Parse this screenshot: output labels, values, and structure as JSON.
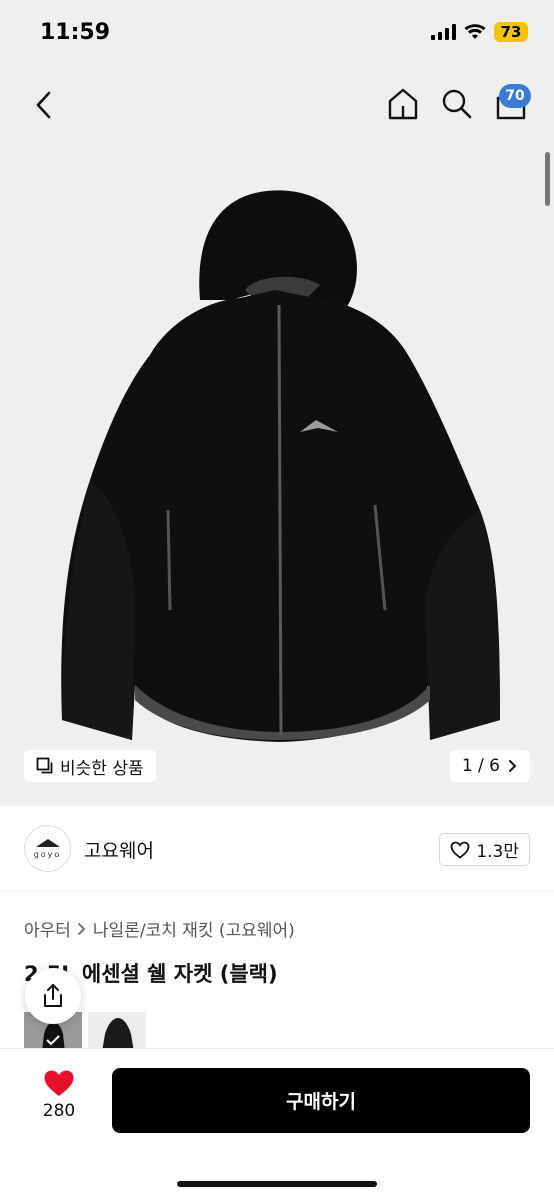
{
  "status": {
    "time": "11:59",
    "battery": "73"
  },
  "header": {
    "cart_count": "70"
  },
  "gallery": {
    "similar_label": "비슷한 상품",
    "page_indicator": "1 / 6"
  },
  "brand": {
    "logo_text": "goyo",
    "name": "고요웨어",
    "like_count": "1.3만"
  },
  "breadcrumb": {
    "category": "아우터",
    "subcategory": "나일론/코치 재킷 (고요웨어)"
  },
  "product": {
    "title": "2.5L 에센셜 쉘 자켓 (블랙)"
  },
  "bottom": {
    "wish_count": "280",
    "buy_label": "구매하기"
  },
  "colors": {
    "accent_badge": "#3a7bd5",
    "wish_heart": "#e8112d",
    "buy_button": "#000000",
    "battery": "#f5c400"
  }
}
